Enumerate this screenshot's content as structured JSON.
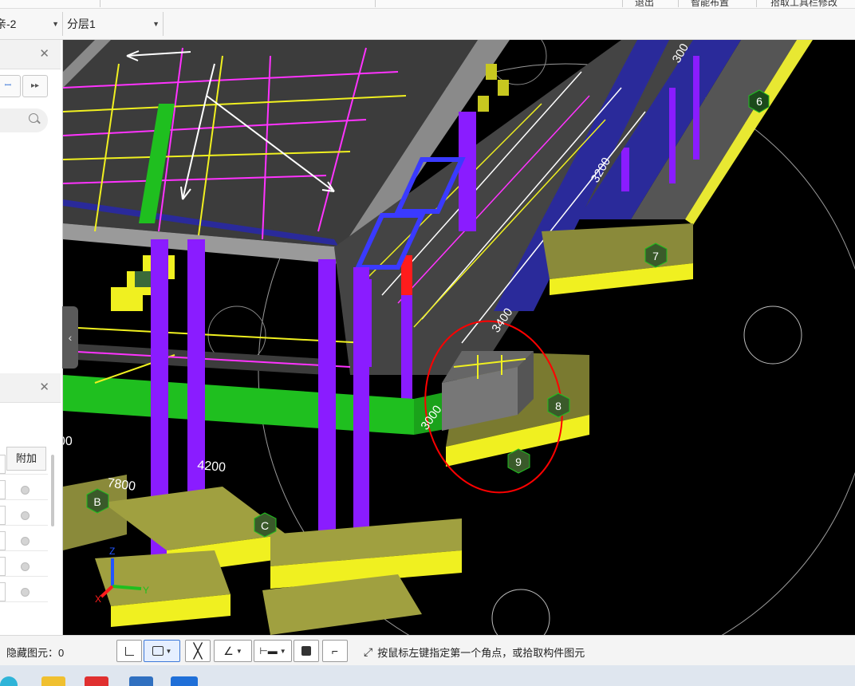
{
  "top_strip": {
    "labels": [
      "退出",
      "智能布置",
      "拾取工具栏修改"
    ]
  },
  "toolbar": {
    "floor_select": "-2",
    "layer_select": "分层1"
  },
  "left_panel": {
    "add_tab_label": "附加",
    "dim_value_partial": "00"
  },
  "viewport": {
    "axis_labels": [
      "6",
      "7",
      "8",
      "9",
      "B",
      "C"
    ],
    "dimensions": [
      "7800",
      "4200",
      "3200",
      "3400",
      "3000",
      "300"
    ],
    "coord_axes": {
      "z": "Z",
      "x": "X",
      "y": "Y"
    },
    "colors": {
      "column": "#8a1cff",
      "beam_green": "#1fbf1f",
      "footing": "#8a8a3a",
      "highlight": "#ff0000"
    }
  },
  "status_bar": {
    "hidden_elements_label": "隐藏图元：",
    "hidden_elements_count": "0",
    "hint_text": "按鼠标左键指定第一个角点，或拾取构件图元",
    "tool_icons": [
      "orthogonal-icon",
      "rectangle-select-icon",
      "cross-icon",
      "angle-icon",
      "offset-icon",
      "snapshot-icon",
      "polyline-icon"
    ]
  },
  "taskbar": {
    "icons": [
      "edge-icon",
      "folder-icon",
      "wps-icon",
      "app-icon",
      "glodon-icon"
    ]
  }
}
